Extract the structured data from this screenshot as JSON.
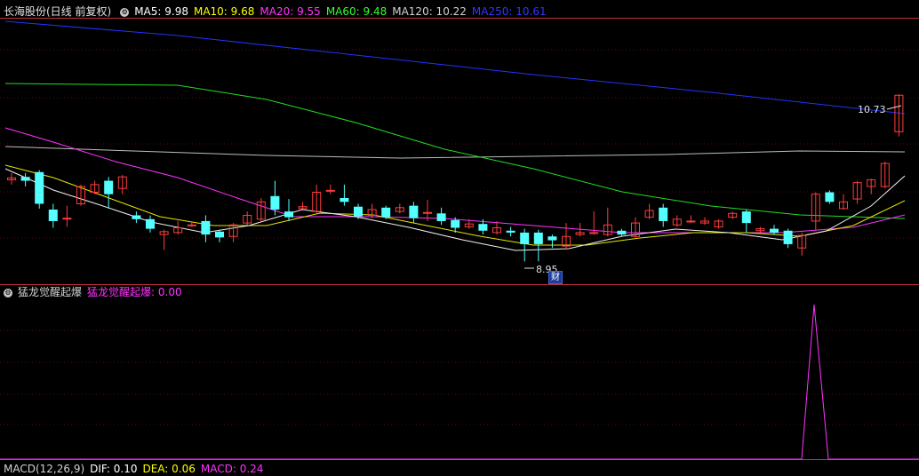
{
  "header": {
    "stock_title": "长海股份(日线 前复权)",
    "ma_values": [
      {
        "label": "MA5: 9.98",
        "color": "#ffffff"
      },
      {
        "label": "MA10: 9.68",
        "color": "#ffff00"
      },
      {
        "label": "MA20: 9.55",
        "color": "#ff00ff"
      },
      {
        "label": "MA60: 9.48",
        "color": "#00ff00"
      },
      {
        "label": "MA120: 10.22",
        "color": "#c0c0c0"
      },
      {
        "label": "MA250: 10.61",
        "color": "#0000ff"
      }
    ]
  },
  "indicator": {
    "name": "猛龙觉醒起爆",
    "value_label": "猛龙觉醒起爆: 0.00"
  },
  "macd": {
    "label": "MACD(12,26,9)",
    "dif": "DIF: 0.10",
    "dea": "DEA: 0.06",
    "macd": "MACD: 0.24"
  },
  "annotations": {
    "high_price": "10.73",
    "low_price": "8.95",
    "cai_marker": "财"
  },
  "colors": {
    "up": "#ff3c3c",
    "down": "#54ffff",
    "panel_border": "#c0303a"
  },
  "chart_data": {
    "type": "candlestick",
    "price_axis": [
      8.8,
      11.5
    ],
    "candles": [
      [
        9.85,
        9.87,
        9.92,
        9.8
      ],
      [
        9.88,
        9.84,
        9.92,
        9.78
      ],
      [
        9.93,
        9.6,
        9.95,
        9.55
      ],
      [
        9.54,
        9.42,
        9.6,
        9.35
      ],
      [
        9.45,
        9.45,
        9.58,
        9.36
      ],
      [
        9.6,
        9.78,
        9.8,
        9.58
      ],
      [
        9.72,
        9.8,
        9.84,
        9.7
      ],
      [
        9.84,
        9.7,
        9.88,
        9.55
      ],
      [
        9.76,
        9.88,
        9.9,
        9.7
      ],
      [
        9.48,
        9.44,
        9.52,
        9.4
      ],
      [
        9.44,
        9.34,
        9.48,
        9.3
      ],
      [
        9.28,
        9.31,
        9.33,
        9.12
      ],
      [
        9.3,
        9.35,
        9.42,
        9.28
      ],
      [
        9.37,
        9.38,
        9.42,
        9.36
      ],
      [
        9.42,
        9.28,
        9.48,
        9.2
      ],
      [
        9.31,
        9.25,
        9.33,
        9.2
      ],
      [
        9.26,
        9.38,
        9.4,
        9.2
      ],
      [
        9.4,
        9.48,
        9.52,
        9.38
      ],
      [
        9.44,
        9.62,
        9.66,
        9.42
      ],
      [
        9.68,
        9.54,
        9.84,
        9.48
      ],
      [
        9.52,
        9.46,
        9.65,
        9.42
      ],
      [
        9.55,
        9.57,
        9.62,
        9.55
      ],
      [
        9.52,
        9.72,
        9.8,
        9.5
      ],
      [
        9.74,
        9.74,
        9.8,
        9.7
      ],
      [
        9.66,
        9.62,
        9.8,
        9.58
      ],
      [
        9.57,
        9.47,
        9.6,
        9.44
      ],
      [
        9.48,
        9.54,
        9.6,
        9.45
      ],
      [
        9.56,
        9.46,
        9.58,
        9.44
      ],
      [
        9.52,
        9.56,
        9.6,
        9.5
      ],
      [
        9.58,
        9.45,
        9.62,
        9.4
      ],
      [
        9.5,
        9.51,
        9.64,
        9.42
      ],
      [
        9.5,
        9.42,
        9.56,
        9.38
      ],
      [
        9.43,
        9.35,
        9.46,
        9.3
      ],
      [
        9.36,
        9.39,
        9.44,
        9.34
      ],
      [
        9.39,
        9.32,
        9.44,
        9.28
      ],
      [
        9.3,
        9.35,
        9.42,
        9.28
      ],
      [
        9.32,
        9.3,
        9.36,
        9.26
      ],
      [
        9.3,
        9.18,
        9.34,
        9.0
      ],
      [
        9.3,
        9.18,
        9.33,
        9.0
      ],
      [
        9.26,
        9.22,
        9.28,
        9.14
      ],
      [
        9.16,
        9.26,
        9.4,
        9.12
      ],
      [
        9.28,
        9.3,
        9.4,
        9.26
      ],
      [
        9.3,
        9.3,
        9.52,
        9.28
      ],
      [
        9.28,
        9.38,
        9.56,
        9.26
      ],
      [
        9.32,
        9.28,
        9.34,
        9.26
      ],
      [
        9.26,
        9.4,
        9.46,
        9.24
      ],
      [
        9.46,
        9.53,
        9.6,
        9.44
      ],
      [
        9.56,
        9.42,
        9.6,
        9.36
      ],
      [
        9.38,
        9.44,
        9.48,
        9.36
      ],
      [
        9.42,
        9.42,
        9.48,
        9.4
      ],
      [
        9.4,
        9.42,
        9.46,
        9.38
      ],
      [
        9.36,
        9.42,
        9.44,
        9.34
      ],
      [
        9.46,
        9.5,
        9.52,
        9.44
      ],
      [
        9.52,
        9.4,
        9.54,
        9.3
      ],
      [
        9.32,
        9.34,
        9.36,
        9.3
      ],
      [
        9.34,
        9.3,
        9.38,
        9.28
      ],
      [
        9.32,
        9.18,
        9.34,
        9.14
      ],
      [
        9.14,
        9.27,
        9.3,
        9.06
      ],
      [
        9.42,
        9.7,
        9.72,
        9.32
      ],
      [
        9.72,
        9.62,
        9.74,
        9.6
      ],
      [
        9.55,
        9.62,
        9.7,
        9.54
      ],
      [
        9.65,
        9.82,
        9.84,
        9.6
      ],
      [
        9.78,
        9.85,
        9.86,
        9.7
      ],
      [
        9.78,
        10.02,
        10.04,
        9.76
      ],
      [
        10.35,
        10.73,
        10.74,
        10.3
      ]
    ]
  }
}
